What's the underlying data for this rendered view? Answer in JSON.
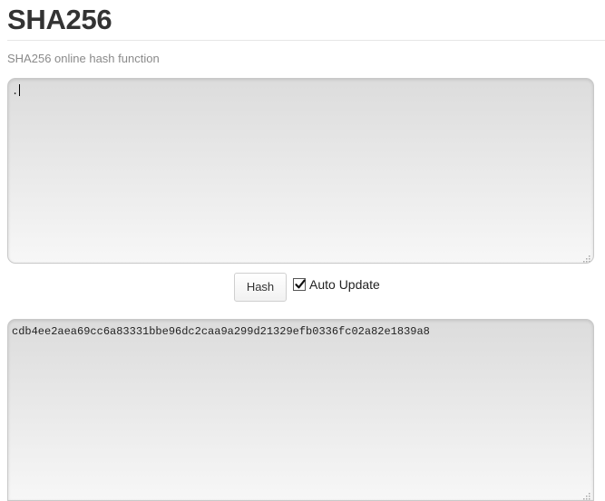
{
  "header": {
    "title": "SHA256",
    "subtitle": "SHA256 online hash function"
  },
  "input": {
    "value": "."
  },
  "controls": {
    "hash_button_label": "Hash",
    "auto_update_label": "Auto Update",
    "auto_update_checked": true
  },
  "output": {
    "value": "cdb4ee2aea69cc6a83331bbe96dc2caa9a299d21329efb0336fc02a82e1839a8"
  }
}
